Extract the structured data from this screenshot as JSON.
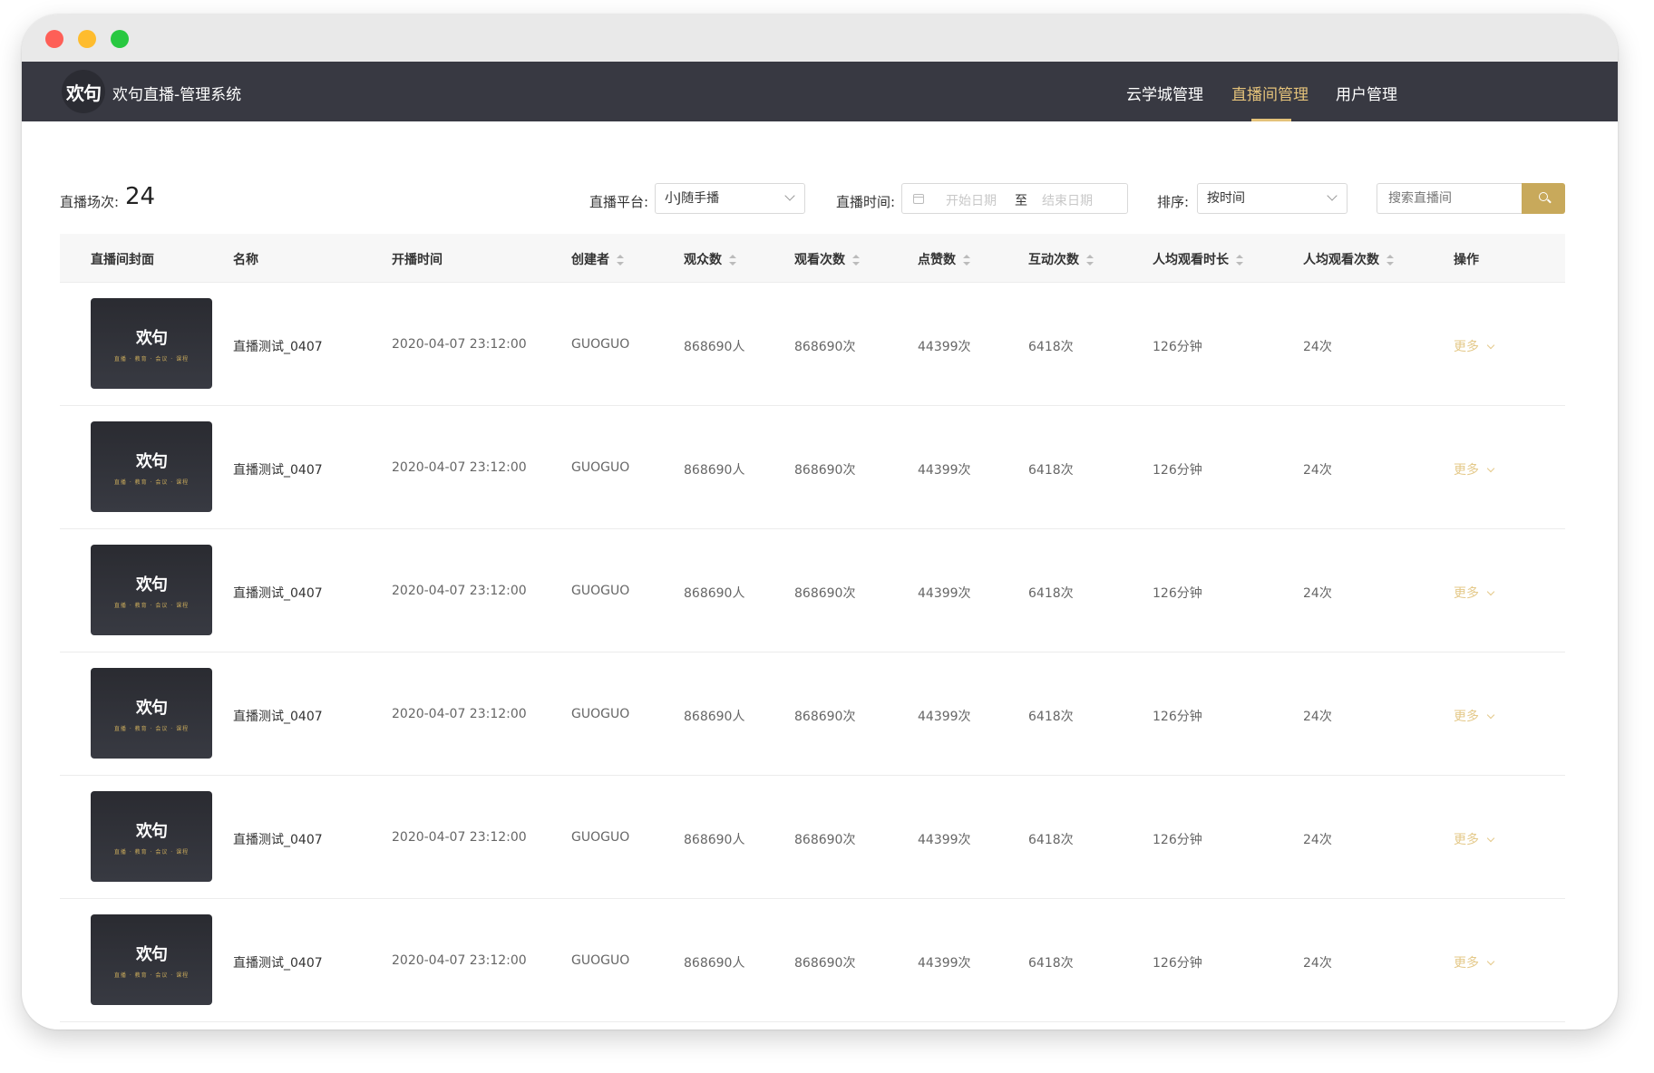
{
  "app": {
    "logo_text": "欢句",
    "title": "欢句直播-管理系统"
  },
  "nav": {
    "items": [
      {
        "label": "云学城管理",
        "active": false
      },
      {
        "label": "直播间管理",
        "active": true
      },
      {
        "label": "用户管理",
        "active": false
      }
    ]
  },
  "summary": {
    "count_label": "直播场次:",
    "count_value": "24"
  },
  "filters": {
    "platform_label": "直播平台:",
    "platform_value": "小J随手播",
    "time_label": "直播时间:",
    "start_placeholder": "开始日期",
    "range_separator": "至",
    "end_placeholder": "结束日期",
    "sort_label": "排序:",
    "sort_value": "按时间",
    "search_placeholder": "搜索直播间"
  },
  "table": {
    "columns": [
      {
        "label": "直播间封面",
        "sortable": false
      },
      {
        "label": "名称",
        "sortable": false
      },
      {
        "label": "开播时间",
        "sortable": false
      },
      {
        "label": "创建者",
        "sortable": true
      },
      {
        "label": "观众数",
        "sortable": true
      },
      {
        "label": "观看次数",
        "sortable": true
      },
      {
        "label": "点赞数",
        "sortable": true
      },
      {
        "label": "互动次数",
        "sortable": true
      },
      {
        "label": "人均观看时长",
        "sortable": true
      },
      {
        "label": "人均观看次数",
        "sortable": true
      },
      {
        "label": "操作",
        "sortable": false
      }
    ],
    "rows": [
      {
        "thumb_logo": "欢句",
        "thumb_sub": "直播 · 教育 · 会议 · 课程",
        "name": "直播测试_0407",
        "start_time": "2020-04-07  23:12:00",
        "creator": "GUOGUO",
        "viewers": "868690人",
        "views": "868690次",
        "likes": "44399次",
        "interactions": "6418次",
        "avg_duration": "126分钟",
        "avg_views": "24次",
        "action": "更多"
      },
      {
        "thumb_logo": "欢句",
        "thumb_sub": "直播 · 教育 · 会议 · 课程",
        "name": "直播测试_0407",
        "start_time": "2020-04-07  23:12:00",
        "creator": "GUOGUO",
        "viewers": "868690人",
        "views": "868690次",
        "likes": "44399次",
        "interactions": "6418次",
        "avg_duration": "126分钟",
        "avg_views": "24次",
        "action": "更多"
      },
      {
        "thumb_logo": "欢句",
        "thumb_sub": "直播 · 教育 · 会议 · 课程",
        "name": "直播测试_0407",
        "start_time": "2020-04-07  23:12:00",
        "creator": "GUOGUO",
        "viewers": "868690人",
        "views": "868690次",
        "likes": "44399次",
        "interactions": "6418次",
        "avg_duration": "126分钟",
        "avg_views": "24次",
        "action": "更多"
      },
      {
        "thumb_logo": "欢句",
        "thumb_sub": "直播 · 教育 · 会议 · 课程",
        "name": "直播测试_0407",
        "start_time": "2020-04-07  23:12:00",
        "creator": "GUOGUO",
        "viewers": "868690人",
        "views": "868690次",
        "likes": "44399次",
        "interactions": "6418次",
        "avg_duration": "126分钟",
        "avg_views": "24次",
        "action": "更多"
      },
      {
        "thumb_logo": "欢句",
        "thumb_sub": "直播 · 教育 · 会议 · 课程",
        "name": "直播测试_0407",
        "start_time": "2020-04-07  23:12:00",
        "creator": "GUOGUO",
        "viewers": "868690人",
        "views": "868690次",
        "likes": "44399次",
        "interactions": "6418次",
        "avg_duration": "126分钟",
        "avg_views": "24次",
        "action": "更多"
      },
      {
        "thumb_logo": "欢句",
        "thumb_sub": "直播 · 教育 · 会议 · 课程",
        "name": "直播测试_0407",
        "start_time": "2020-04-07  23:12:00",
        "creator": "GUOGUO",
        "viewers": "868690人",
        "views": "868690次",
        "likes": "44399次",
        "interactions": "6418次",
        "avg_duration": "126分钟",
        "avg_views": "24次",
        "action": "更多"
      }
    ]
  },
  "colors": {
    "nav_bg": "#383942",
    "accent": "#c8a95b",
    "nav_active": "#e4c27a"
  }
}
